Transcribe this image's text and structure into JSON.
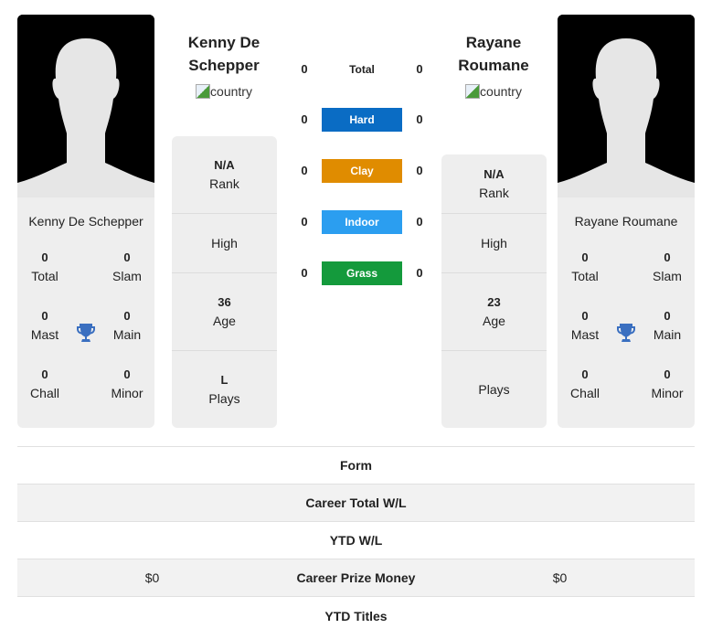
{
  "players": [
    {
      "name": "Kenny De Schepper",
      "name_line1": "Kenny De",
      "name_line2": "Schepper",
      "flag_alt": "country",
      "titles": {
        "total": {
          "value": "0",
          "label": "Total"
        },
        "slam": {
          "value": "0",
          "label": "Slam"
        },
        "mast": {
          "value": "0",
          "label": "Mast"
        },
        "main": {
          "value": "0",
          "label": "Main"
        },
        "chall": {
          "value": "0",
          "label": "Chall"
        },
        "minor": {
          "value": "0",
          "label": "Minor"
        }
      },
      "info": {
        "rank": {
          "value": "N/A",
          "label": "Rank"
        },
        "high": {
          "value": "",
          "label": "High"
        },
        "age": {
          "value": "36",
          "label": "Age"
        },
        "plays": {
          "value": "L",
          "label": "Plays"
        }
      }
    },
    {
      "name": "Rayane Roumane",
      "name_line1": "Rayane",
      "name_line2": "Roumane",
      "flag_alt": "country",
      "titles": {
        "total": {
          "value": "0",
          "label": "Total"
        },
        "slam": {
          "value": "0",
          "label": "Slam"
        },
        "mast": {
          "value": "0",
          "label": "Mast"
        },
        "main": {
          "value": "0",
          "label": "Main"
        },
        "chall": {
          "value": "0",
          "label": "Chall"
        },
        "minor": {
          "value": "0",
          "label": "Minor"
        }
      },
      "info": {
        "rank": {
          "value": "N/A",
          "label": "Rank"
        },
        "high": {
          "value": "",
          "label": "High"
        },
        "age": {
          "value": "23",
          "label": "Age"
        },
        "plays": {
          "value": "",
          "label": "Plays"
        }
      }
    }
  ],
  "surfaces": [
    {
      "label": "Total",
      "left": "0",
      "right": "0",
      "color": ""
    },
    {
      "label": "Hard",
      "left": "0",
      "right": "0",
      "color": "#0a6cc4"
    },
    {
      "label": "Clay",
      "left": "0",
      "right": "0",
      "color": "#e08c00"
    },
    {
      "label": "Indoor",
      "left": "0",
      "right": "0",
      "color": "#2b9ef0"
    },
    {
      "label": "Grass",
      "left": "0",
      "right": "0",
      "color": "#149a3c"
    }
  ],
  "comparison": [
    {
      "label": "Form",
      "left": "",
      "right": ""
    },
    {
      "label": "Career Total W/L",
      "left": "",
      "right": ""
    },
    {
      "label": "YTD W/L",
      "left": "",
      "right": ""
    },
    {
      "label": "Career Prize Money",
      "left": "$0",
      "right": "$0"
    },
    {
      "label": "YTD Titles",
      "left": "",
      "right": ""
    }
  ],
  "colors": {
    "trophy": "#3a6fc0",
    "card_bg": "#eeeeee"
  }
}
